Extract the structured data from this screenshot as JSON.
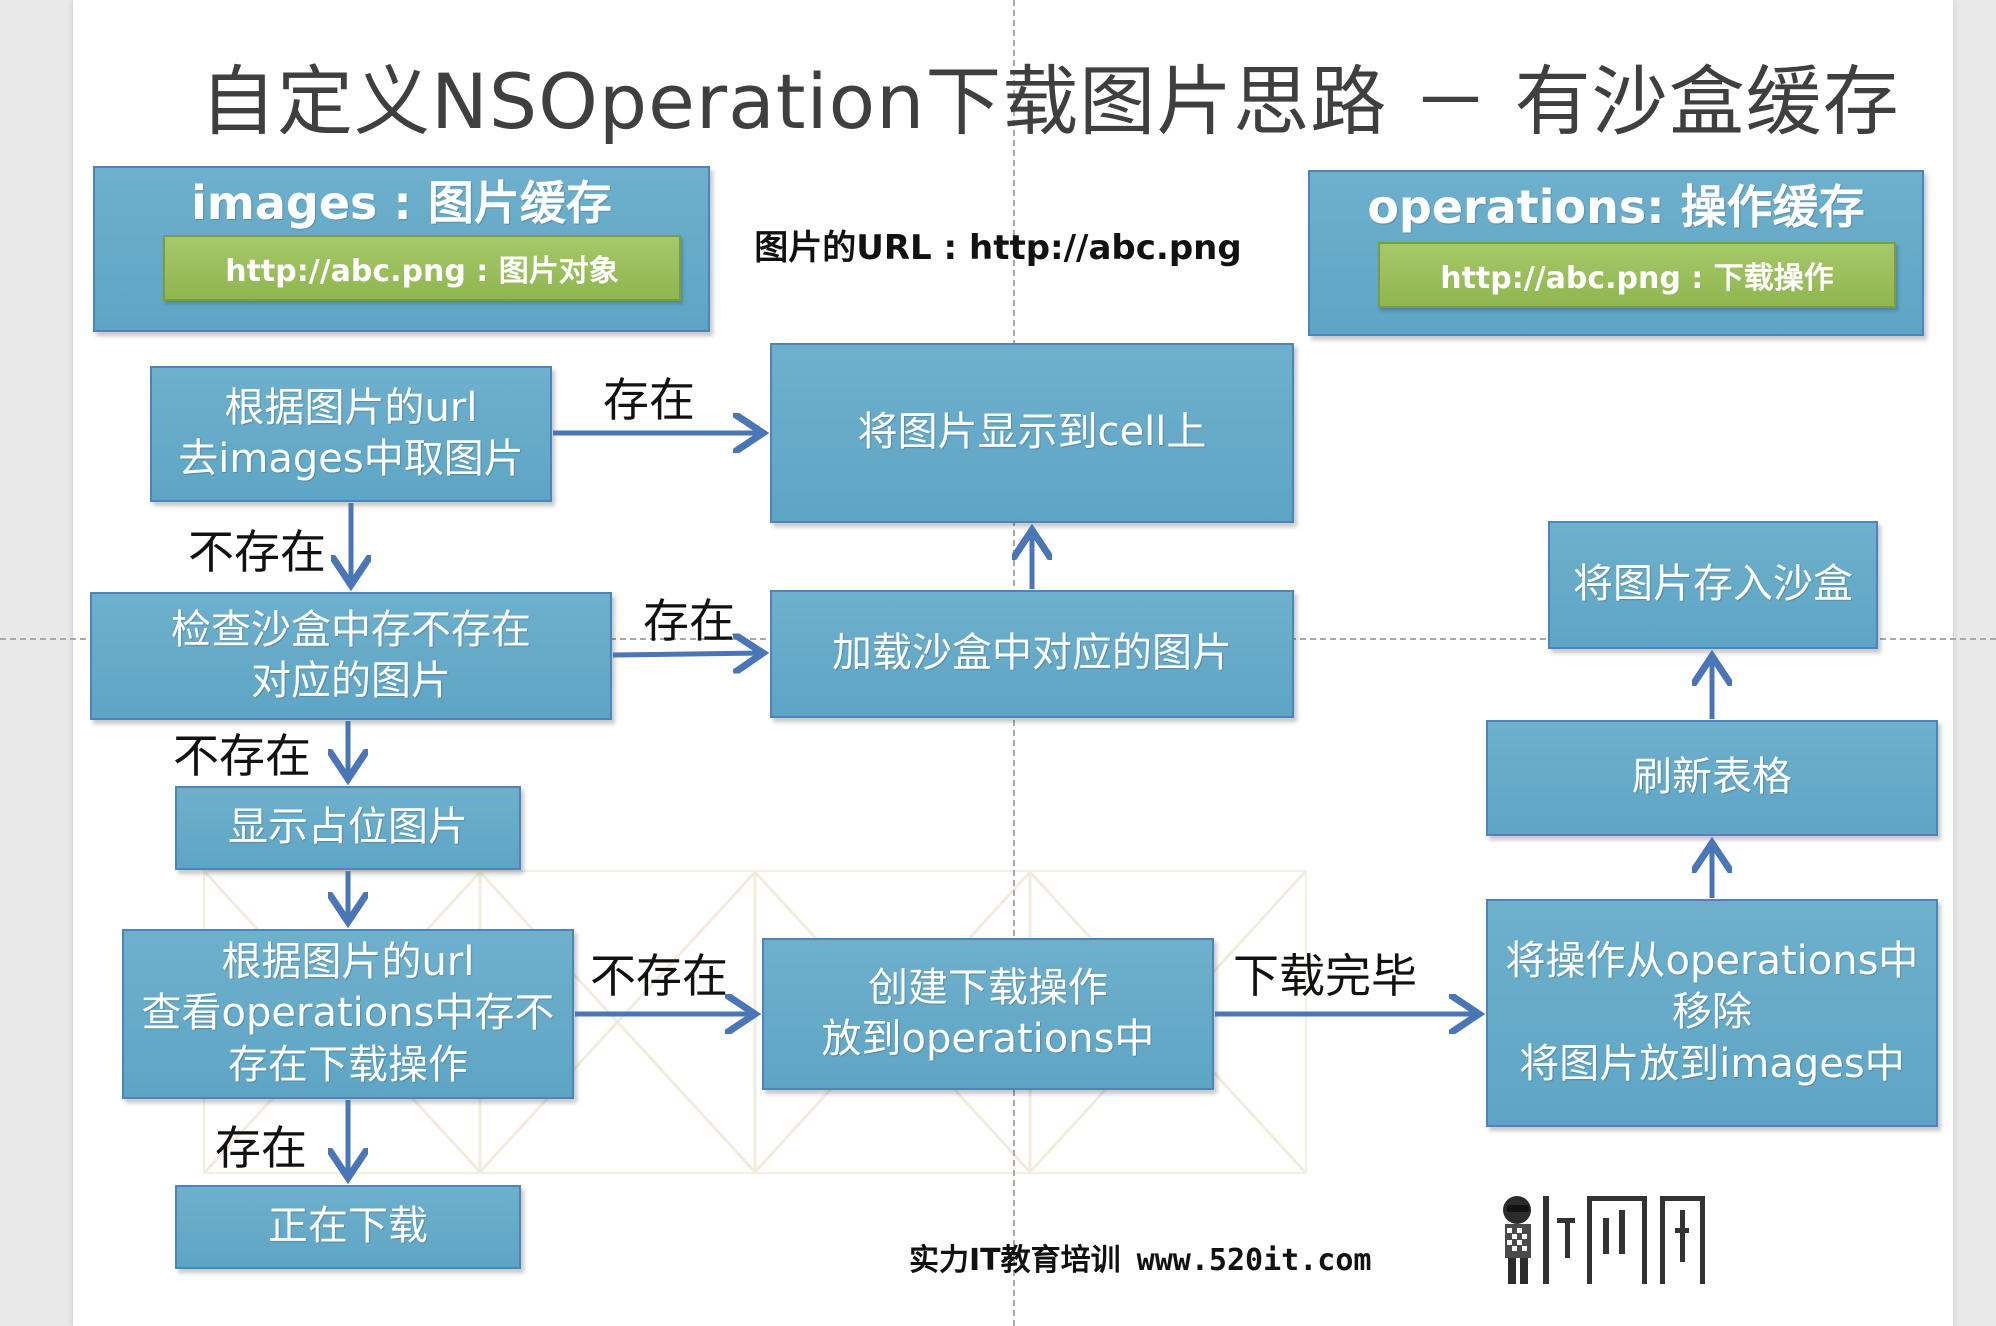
{
  "title": "自定义NSOperation下载图片思路 － 有沙盒缓存",
  "images_cache": {
    "title": "images : 图片缓存",
    "entry": "http://abc.png : 图片对象"
  },
  "operations_cache": {
    "title": "operations: 操作缓存",
    "entry": "http://abc.png : 下载操作"
  },
  "url_label": "图片的URL : http://abc.png",
  "nodes": {
    "lookup_images": [
      "根据图片的url",
      "去images中取图片"
    ],
    "show_in_cell": [
      "将图片显示到cell上"
    ],
    "check_sandbox": [
      "检查沙盒中存不存在",
      "对应的图片"
    ],
    "load_sandbox": [
      "加载沙盒中对应的图片"
    ],
    "placeholder": [
      "显示占位图片"
    ],
    "check_operations": [
      "根据图片的url",
      "查看operations中存不",
      "存在下载操作"
    ],
    "create_operation": [
      "创建下载操作",
      "放到operations中"
    ],
    "downloading": [
      "正在下载"
    ],
    "finish": [
      "将操作从operations中",
      "移除",
      "将图片放到images中"
    ],
    "refresh": [
      "刷新表格"
    ],
    "save_sandbox": [
      "将图片存入沙盒"
    ]
  },
  "edge_labels": {
    "exists_1": "存在",
    "not_exists_1": "不存在",
    "exists_2": "存在",
    "not_exists_2": "不存在",
    "not_exists_3": "不存在",
    "exists_3": "存在",
    "download_done": "下载完毕"
  },
  "footer": {
    "org": "实力IT教育培训",
    "url": "www.520it.com"
  },
  "colors": {
    "box_fill": "#64a8c7",
    "box_border": "#4d84bb",
    "entry_fill": "#9bbf5c",
    "arrow": "#4a76b8"
  }
}
